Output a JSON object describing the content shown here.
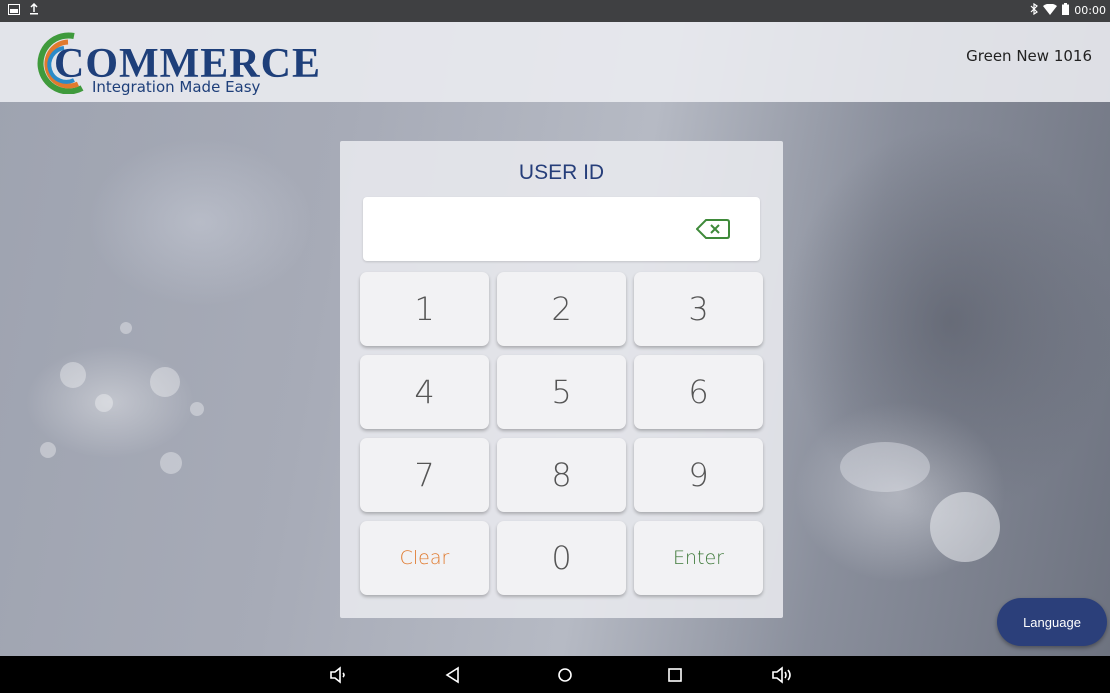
{
  "status_bar": {
    "time": "00:00",
    "left_icons": [
      "screenshot-icon",
      "upload-icon"
    ],
    "right_icons": [
      "bluetooth-icon",
      "wifi-icon",
      "battery-icon"
    ]
  },
  "header": {
    "logo_word": "COMMERCE",
    "logo_tagline": "Integration Made Easy",
    "store_name": "Green New 1016"
  },
  "login": {
    "title": "USER ID",
    "input_value": "",
    "keys": [
      "1",
      "2",
      "3",
      "4",
      "5",
      "6",
      "7",
      "8",
      "9"
    ],
    "zero": "0",
    "clear_label": "Clear",
    "enter_label": "Enter"
  },
  "language_button": {
    "label": "Language"
  },
  "nav_bar": {
    "icons": [
      "volume-down-icon",
      "back-icon",
      "home-icon",
      "recents-icon",
      "volume-up-icon"
    ]
  },
  "colors": {
    "brand_blue": "#263e7a",
    "clear_orange": "#e07a2e",
    "enter_green": "#3f7a3a"
  }
}
